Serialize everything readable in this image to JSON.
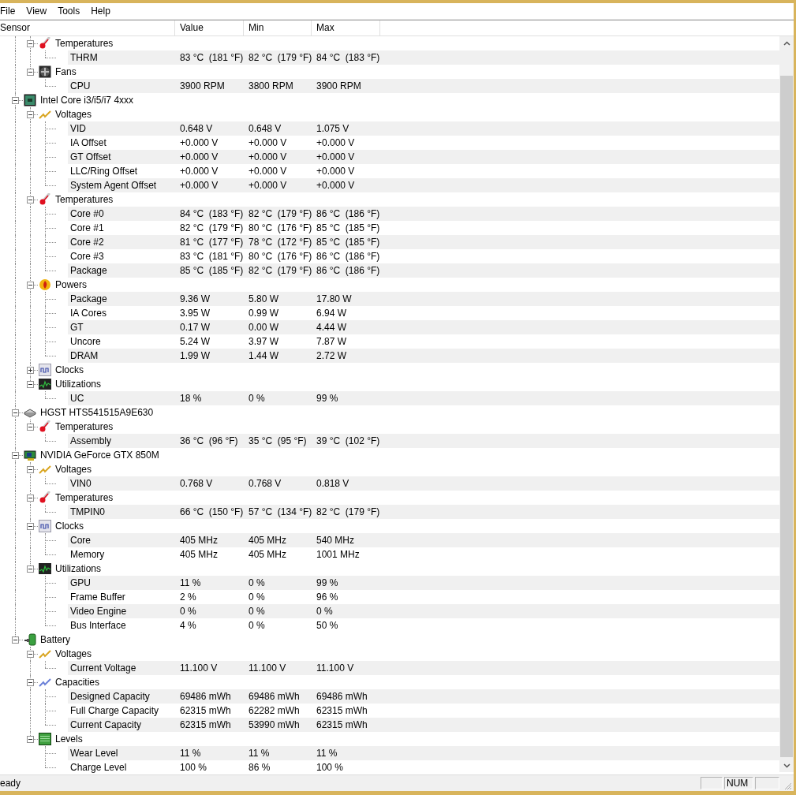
{
  "menu": [
    "File",
    "View",
    "Tools",
    "Help"
  ],
  "columns": [
    "Sensor",
    "Value",
    "Min",
    "Max"
  ],
  "tree": [
    {
      "children": [
        {
          "kind": "temperatures",
          "name": "Temperatures",
          "expanded": true,
          "children": [
            {
              "name": "THRM",
              "value": "83 °C  (181 °F)",
              "min": "82 °C  (179 °F)",
              "max": "84 °C  (183 °F)"
            }
          ]
        },
        {
          "kind": "fans",
          "name": "Fans",
          "expanded": true,
          "children": [
            {
              "name": "CPU",
              "value": "3900 RPM",
              "min": "3800 RPM",
              "max": "3900 RPM"
            }
          ]
        }
      ]
    },
    {
      "kind": "cpu",
      "name": "Intel Core i3/i5/i7 4xxx",
      "expanded": true,
      "children": [
        {
          "kind": "voltages",
          "name": "Voltages",
          "expanded": true,
          "children": [
            {
              "name": "VID",
              "value": "0.648 V",
              "min": "0.648 V",
              "max": "1.075 V"
            },
            {
              "name": "IA Offset",
              "value": "+0.000 V",
              "min": "+0.000 V",
              "max": "+0.000 V"
            },
            {
              "name": "GT Offset",
              "value": "+0.000 V",
              "min": "+0.000 V",
              "max": "+0.000 V"
            },
            {
              "name": "LLC/Ring Offset",
              "value": "+0.000 V",
              "min": "+0.000 V",
              "max": "+0.000 V"
            },
            {
              "name": "System Agent Offset",
              "value": "+0.000 V",
              "min": "+0.000 V",
              "max": "+0.000 V"
            }
          ]
        },
        {
          "kind": "temperatures",
          "name": "Temperatures",
          "expanded": true,
          "children": [
            {
              "name": "Core #0",
              "value": "84 °C  (183 °F)",
              "min": "82 °C  (179 °F)",
              "max": "86 °C  (186 °F)"
            },
            {
              "name": "Core #1",
              "value": "82 °C  (179 °F)",
              "min": "80 °C  (176 °F)",
              "max": "85 °C  (185 °F)"
            },
            {
              "name": "Core #2",
              "value": "81 °C  (177 °F)",
              "min": "78 °C  (172 °F)",
              "max": "85 °C  (185 °F)"
            },
            {
              "name": "Core #3",
              "value": "83 °C  (181 °F)",
              "min": "80 °C  (176 °F)",
              "max": "86 °C  (186 °F)"
            },
            {
              "name": "Package",
              "value": "85 °C  (185 °F)",
              "min": "82 °C  (179 °F)",
              "max": "86 °C  (186 °F)"
            }
          ]
        },
        {
          "kind": "powers",
          "name": "Powers",
          "expanded": true,
          "children": [
            {
              "name": "Package",
              "value": "9.36 W",
              "min": "5.80 W",
              "max": "17.80 W"
            },
            {
              "name": "IA Cores",
              "value": "3.95 W",
              "min": "0.99 W",
              "max": "6.94 W"
            },
            {
              "name": "GT",
              "value": "0.17 W",
              "min": "0.00 W",
              "max": "4.44 W"
            },
            {
              "name": "Uncore",
              "value": "5.24 W",
              "min": "3.97 W",
              "max": "7.87 W"
            },
            {
              "name": "DRAM",
              "value": "1.99 W",
              "min": "1.44 W",
              "max": "2.72 W"
            }
          ]
        },
        {
          "kind": "clocks",
          "name": "Clocks",
          "expanded": false
        },
        {
          "kind": "utilizations",
          "name": "Utilizations",
          "expanded": true,
          "children": [
            {
              "name": "UC",
              "value": "18 %",
              "min": "0 %",
              "max": "99 %"
            }
          ]
        }
      ]
    },
    {
      "kind": "disk",
      "name": "HGST HTS541515A9E630",
      "expanded": true,
      "children": [
        {
          "kind": "temperatures",
          "name": "Temperatures",
          "expanded": true,
          "children": [
            {
              "name": "Assembly",
              "value": "36 °C  (96 °F)",
              "min": "35 °C  (95 °F)",
              "max": "39 °C  (102 °F)"
            }
          ]
        }
      ]
    },
    {
      "kind": "gpu",
      "name": "NVIDIA GeForce GTX 850M",
      "expanded": true,
      "children": [
        {
          "kind": "voltages",
          "name": "Voltages",
          "expanded": true,
          "children": [
            {
              "name": "VIN0",
              "value": "0.768 V",
              "min": "0.768 V",
              "max": "0.818 V"
            }
          ]
        },
        {
          "kind": "temperatures",
          "name": "Temperatures",
          "expanded": true,
          "children": [
            {
              "name": "TMPIN0",
              "value": "66 °C  (150 °F)",
              "min": "57 °C  (134 °F)",
              "max": "82 °C  (179 °F)"
            }
          ]
        },
        {
          "kind": "clocks",
          "name": "Clocks",
          "expanded": true,
          "children": [
            {
              "name": "Core",
              "value": "405 MHz",
              "min": "405 MHz",
              "max": "540 MHz"
            },
            {
              "name": "Memory",
              "value": "405 MHz",
              "min": "405 MHz",
              "max": "1001 MHz"
            }
          ]
        },
        {
          "kind": "utilizations",
          "name": "Utilizations",
          "expanded": true,
          "children": [
            {
              "name": "GPU",
              "value": "11 %",
              "min": "0 %",
              "max": "99 %"
            },
            {
              "name": "Frame Buffer",
              "value": "2 %",
              "min": "0 %",
              "max": "96 %"
            },
            {
              "name": "Video Engine",
              "value": "0 %",
              "min": "0 %",
              "max": "0 %"
            },
            {
              "name": "Bus Interface",
              "value": "4 %",
              "min": "0 %",
              "max": "50 %"
            }
          ]
        }
      ]
    },
    {
      "kind": "battery",
      "name": "Battery",
      "expanded": true,
      "children": [
        {
          "kind": "voltages",
          "name": "Voltages",
          "expanded": true,
          "children": [
            {
              "name": "Current Voltage",
              "value": "11.100 V",
              "min": "11.100 V",
              "max": "11.100 V"
            }
          ]
        },
        {
          "kind": "capacities",
          "name": "Capacities",
          "expanded": true,
          "children": [
            {
              "name": "Designed Capacity",
              "value": "69486 mWh",
              "min": "69486 mWh",
              "max": "69486 mWh"
            },
            {
              "name": "Full Charge Capacity",
              "value": "62315 mWh",
              "min": "62282 mWh",
              "max": "62315 mWh"
            },
            {
              "name": "Current Capacity",
              "value": "62315 mWh",
              "min": "53990 mWh",
              "max": "62315 mWh"
            }
          ]
        },
        {
          "kind": "levels",
          "name": "Levels",
          "expanded": true,
          "children": [
            {
              "name": "Wear Level",
              "value": "11 %",
              "min": "11 %",
              "max": "11 %"
            },
            {
              "name": "Charge Level",
              "value": "100 %",
              "min": "86 %",
              "max": "100 %"
            }
          ]
        }
      ]
    }
  ],
  "status": {
    "text": "eady",
    "indicator": "NUM"
  }
}
